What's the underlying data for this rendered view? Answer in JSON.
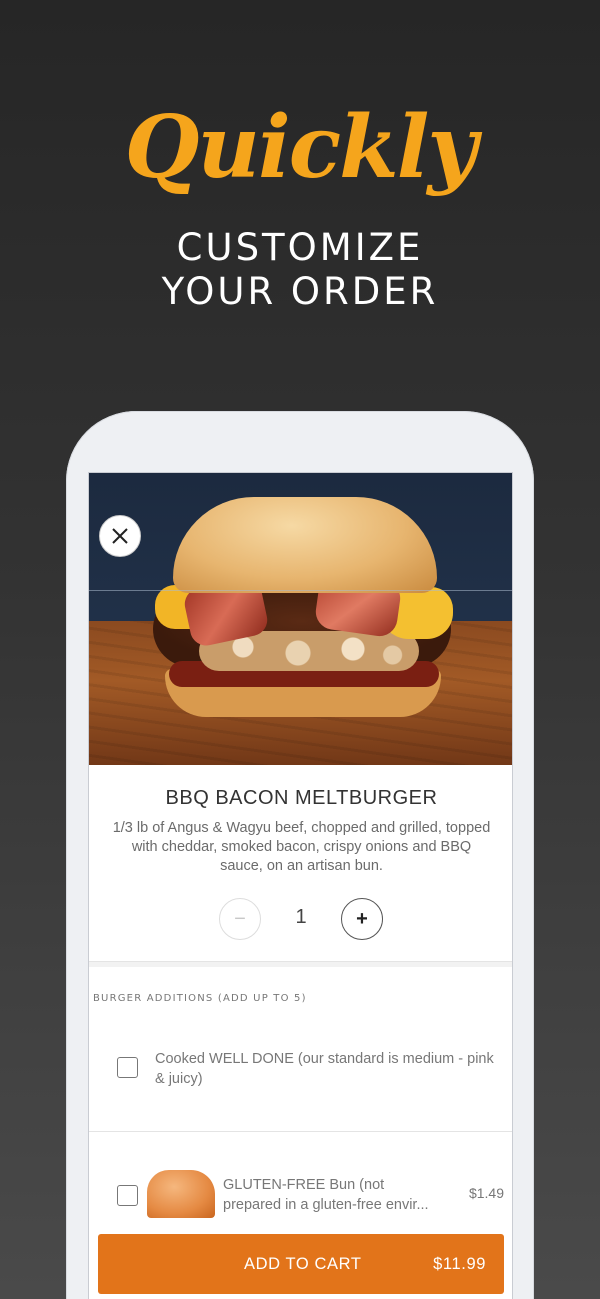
{
  "hero": {
    "script_title": "Quickly",
    "subtitle_line1": "CUSTOMIZE",
    "subtitle_line2": "YOUR ORDER"
  },
  "product": {
    "name": "BBQ BACON MELTBURGER",
    "description": "1/3 lb of Angus & Wagyu beef, chopped and grilled, topped with cheddar, smoked bacon, crispy onions and BBQ sauce, on an artisan bun.",
    "quantity": "1",
    "minus_label": "−",
    "plus_label": "+"
  },
  "additions": {
    "section_label": "BURGER ADDITIONS (ADD UP TO 5)",
    "options": [
      {
        "label": "Cooked WELL DONE (our standard is medium - pink & juicy)",
        "checked": false
      },
      {
        "label_line1": "GLUTEN-FREE Bun (not",
        "label_line2": "prepared in a gluten-free envir...",
        "price": "$1.49",
        "checked": false
      }
    ]
  },
  "cart": {
    "label": "ADD TO CART",
    "price": "$11.99"
  },
  "colors": {
    "accent": "#e2741a",
    "script": "#f5a51c"
  },
  "icons": {
    "close": "close-icon"
  }
}
